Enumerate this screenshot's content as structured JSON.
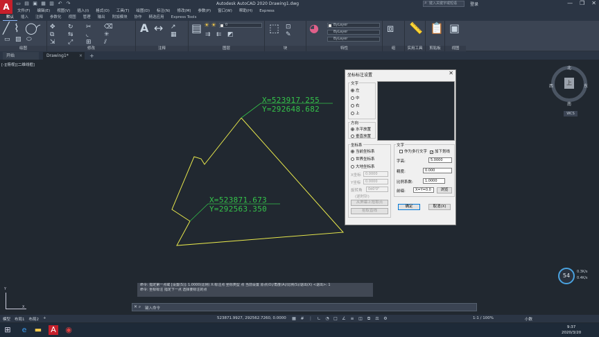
{
  "app": {
    "logo": "A",
    "title": "Autodesk AutoCAD 2020    Drawing1.dwg",
    "search_placeholder": "键入关键字或短语",
    "login": "登录",
    "window_controls": [
      "—",
      "❐",
      "✕"
    ]
  },
  "menus": [
    "文件(F)",
    "编辑(E)",
    "视图(V)",
    "插入(I)",
    "格式(O)",
    "工具(T)",
    "绘图(D)",
    "标注(N)",
    "修改(M)",
    "参数(P)",
    "窗口(W)",
    "帮助(H)",
    "Express"
  ],
  "ribbon_tabs": [
    "默认",
    "插入",
    "注释",
    "参数化",
    "视图",
    "管理",
    "输出",
    "附加模块",
    "协作",
    "精选应用",
    "Express Tools"
  ],
  "ribbon_panels": {
    "draw": "绘图",
    "modify": "修改",
    "annotation": "注释",
    "layers": "图层",
    "block": "块",
    "properties": "特性",
    "groups": "组",
    "utilities": "实用工具",
    "clipboard": "剪贴板",
    "view": "视图"
  },
  "ribbon_controls": {
    "layer_combo": "0",
    "prop_color": "ByLayer",
    "prop_linetype": "ByLayer",
    "prop_lineweight": "ByLayer"
  },
  "file_tabs": {
    "start": "开始",
    "drawing": "Drawing1*",
    "close": "×",
    "new": "+"
  },
  "viewport_label": "[-][俯视][二维线框]",
  "coords": {
    "top_x": "X=523917.255",
    "top_y": "Y=292648.682",
    "bottom_x": "X=523871.673",
    "bottom_y": "Y=292563.350"
  },
  "viewcube": {
    "face": "上",
    "north": "北",
    "south": "南",
    "east": "东",
    "west": "西",
    "wcs": "WCS"
  },
  "dialog": {
    "title": "坐标标注设置",
    "close": "✕",
    "group_text": "文字",
    "options_text": [
      "左",
      "中",
      "右",
      "上"
    ],
    "group_dir": "方向",
    "options_dir": [
      "水平放置",
      "垂直放置"
    ],
    "group_coord": "坐标系",
    "options_coord": [
      "当前坐标系",
      "世界坐标系",
      "大地坐标系"
    ],
    "x_label": "X坐标",
    "x_value": "0.0000",
    "y_label": "Y坐标",
    "y_value": "0.0000",
    "angle_label": "旋转角",
    "angle_value": "0d0'0\"",
    "angle_hint": "(逆时针)",
    "pick_point_btn": "从屏幕上拾取点",
    "pick_line_btn": "拾取直线",
    "group_font": "文字",
    "chk_mtext": "作为多行文字",
    "chk_underline": "加下划线",
    "height_label": "字高:",
    "height_value": "5.0000",
    "precision_label": "精度:",
    "precision_value": "0.000",
    "scale_label": "比例系数:",
    "scale_value": "1.0000",
    "prefix_label": "前缀:",
    "prefix_value": "X=Y=0.0",
    "browse_btn": "浏览",
    "ok_btn": "确定",
    "cancel_btn": "取消(X)"
  },
  "command": {
    "history": [
      "命令: 指定第一点或 [设置(S)]: 1.0000(比例)  X:标注点  坐标类型  点 当前设置  原点(O)/角度(A)/比例(S)/退出(X) <退出>: 1",
      "命令: 坐标标注  指定下一点  选择要标注的点"
    ],
    "prompt": "键入命令"
  },
  "status": {
    "layouts": [
      "模型",
      "布局1",
      "布局2",
      "+"
    ],
    "coords": "523871.9927, 292562.7260, 0.0000",
    "scale": "1:1 / 100%",
    "mode": "小数"
  },
  "perf": {
    "value": "54",
    "up": "0.3K/s",
    "down": "0.4K/s"
  },
  "clock": {
    "time": "9:37",
    "date": "2020/3/20"
  },
  "colors": {
    "coord_text": "#34c34a",
    "polyline": "#e8e84c",
    "accent": "#c6202b"
  }
}
